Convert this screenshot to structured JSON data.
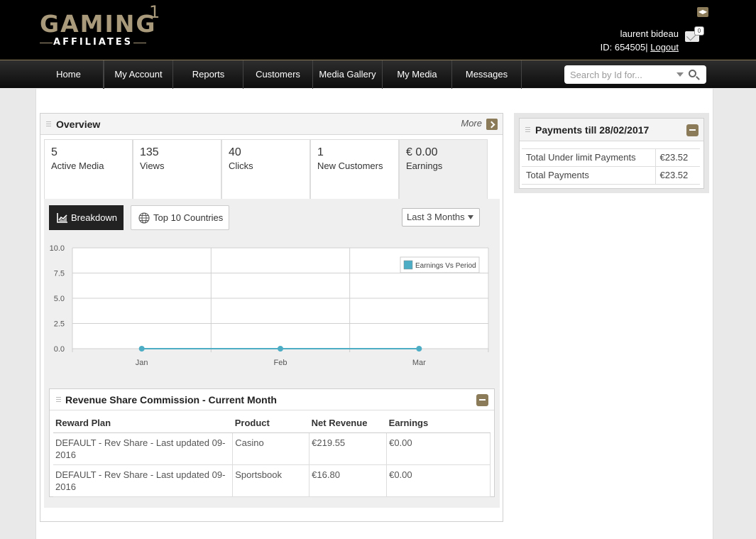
{
  "brand": {
    "name": "GAMING",
    "superscript": "1",
    "tagline": "AFFILIATES"
  },
  "user": {
    "name": "laurent bideau",
    "id_label": "ID: 654505|",
    "logout": "Logout",
    "mail_count": "0"
  },
  "nav": {
    "items": [
      "Home",
      "My Account",
      "Reports",
      "Customers",
      "Media Gallery",
      "My Media",
      "Messages"
    ],
    "search_placeholder": "Search by Id for..."
  },
  "overview": {
    "title": "Overview",
    "more": "More",
    "stats": [
      {
        "value": "5",
        "label": "Active Media"
      },
      {
        "value": "135",
        "label": "Views"
      },
      {
        "value": "40",
        "label": "Clicks"
      },
      {
        "value": "1",
        "label": "New Customers"
      },
      {
        "value": "€ 0.00",
        "label": "Earnings"
      }
    ],
    "buttons": {
      "breakdown": "Breakdown",
      "countries": "Top 10 Countries"
    },
    "period": "Last 3 Months"
  },
  "chart_data": {
    "type": "line",
    "categories": [
      "Jan",
      "Feb",
      "Mar"
    ],
    "series": [
      {
        "name": "Earnings Vs Period",
        "values": [
          0,
          0,
          0
        ],
        "color": "#4cadc4"
      }
    ],
    "ylim": [
      0,
      10
    ],
    "yticks": [
      "0.0",
      "2.5",
      "5.0",
      "7.5",
      "10.0"
    ],
    "grid": true,
    "legend": "top-right"
  },
  "revenue": {
    "title": "Revenue Share Commission - Current Month",
    "columns": [
      "Reward Plan",
      "Product",
      "Net Revenue",
      "Earnings"
    ],
    "rows": [
      [
        "DEFAULT - Rev Share - Last updated 09-2016",
        "Casino",
        "€219.55",
        "€0.00"
      ],
      [
        "DEFAULT - Rev Share - Last updated 09-2016",
        "Sportsbook",
        "€16.80",
        "€0.00"
      ]
    ]
  },
  "payments": {
    "title": "Payments till 28/02/2017",
    "rows": [
      {
        "label": "Total Under limit Payments",
        "value": "€23.52"
      },
      {
        "label": "Total Payments",
        "value": "€23.52"
      }
    ]
  },
  "colors": {
    "accent": "#8b7b58",
    "line": "#4cadc4",
    "header": "#000000"
  }
}
